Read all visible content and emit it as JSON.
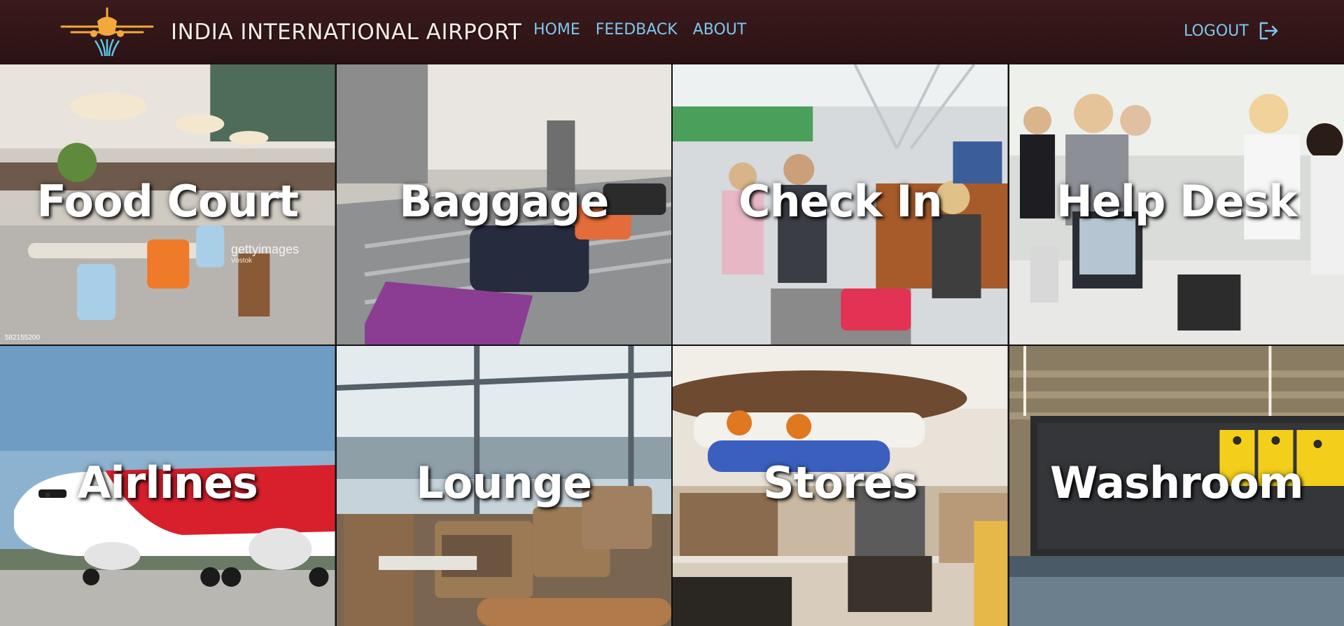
{
  "header": {
    "title": "INDIA INTERNATIONAL AIRPORT",
    "logo_icon": "airplane-logo-icon",
    "nav": [
      {
        "label": "HOME"
      },
      {
        "label": "FEEDBACK"
      },
      {
        "label": "ABOUT"
      }
    ],
    "logout_label": "LOGOUT",
    "logout_icon": "logout-icon",
    "colors": {
      "nav_bg": "#2f1517",
      "link": "#7ec7ef",
      "title": "#f1ece4"
    }
  },
  "tiles": [
    {
      "label": "Food Court",
      "watermark": "gettyimages",
      "watermark_sub": "Vostok",
      "image_id": "582155200"
    },
    {
      "label": "Baggage"
    },
    {
      "label": "Check In"
    },
    {
      "label": "Help Desk"
    },
    {
      "label": "Airlines"
    },
    {
      "label": "Lounge"
    },
    {
      "label": "Stores"
    },
    {
      "label": "Washroom"
    }
  ]
}
